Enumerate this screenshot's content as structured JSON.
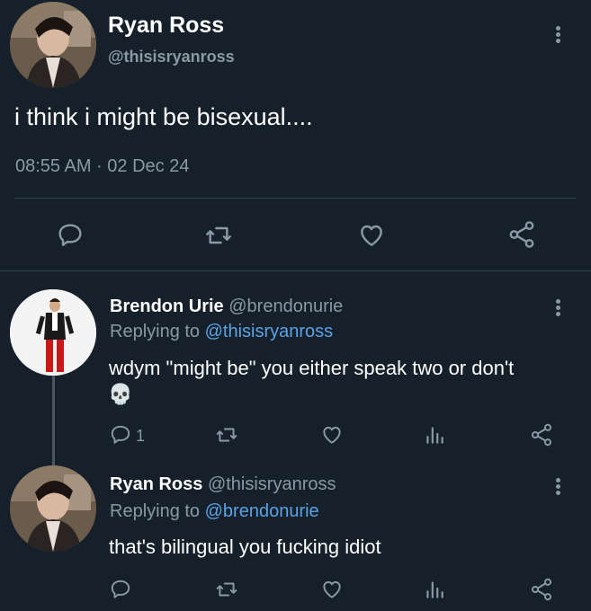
{
  "main_tweet": {
    "author_name": "Ryan Ross",
    "author_handle": "@thisisryanross",
    "text": "i think i might be bisexual....",
    "timestamp": "08:55 AM · 02 Dec 24",
    "actions": {
      "reply_icon": "reply-icon",
      "retweet_icon": "retweet-icon",
      "like_icon": "heart-icon",
      "share_icon": "share-icon"
    }
  },
  "replies": [
    {
      "author_name": "Brendon Urie",
      "author_handle": "@brendonurie",
      "replying_to_label": "Replying to",
      "replying_to_handle": "@thisisryanross",
      "text": "wdym \"might be\" you either speak two or don't",
      "emoji": "💀",
      "reply_count": "1"
    },
    {
      "author_name": "Ryan Ross",
      "author_handle": "@thisisryanross",
      "replying_to_label": "Replying to",
      "replying_to_handle": "@brendonurie",
      "text": "that's bilingual you fucking idiot"
    }
  ],
  "colors": {
    "background": "#15202b",
    "muted": "#8b98a5",
    "link": "#5aa3e6",
    "divider": "#38444d"
  }
}
